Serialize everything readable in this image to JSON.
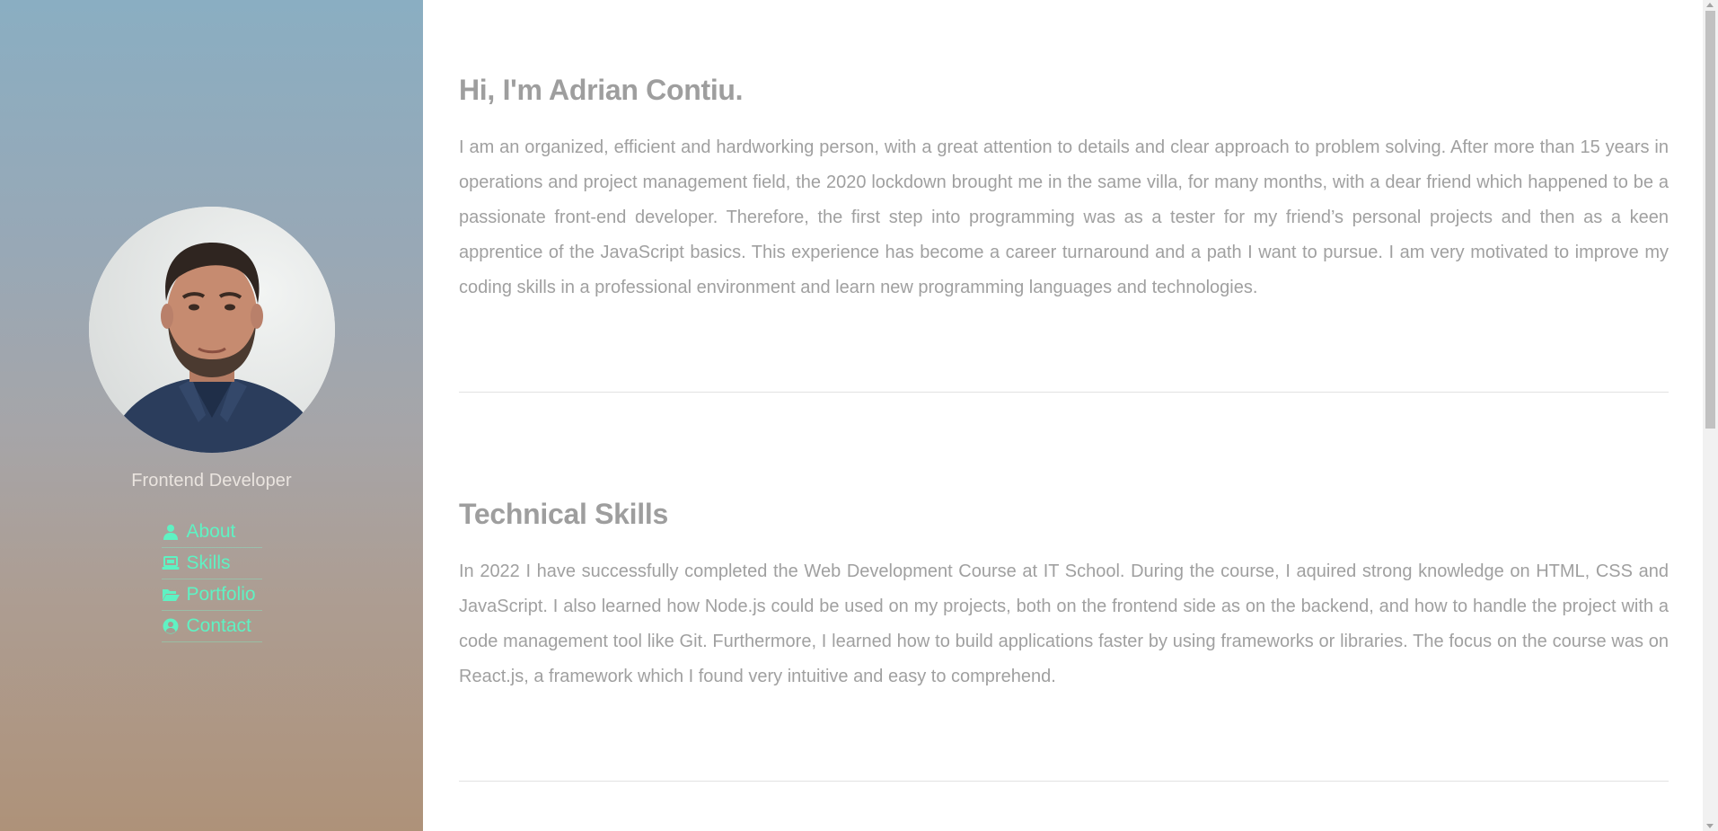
{
  "sidebar": {
    "role": "Frontend Developer",
    "nav": [
      {
        "label": "About",
        "icon": "user-icon"
      },
      {
        "label": "Skills",
        "icon": "laptop-icon"
      },
      {
        "label": "Portfolio",
        "icon": "folder-open-icon"
      },
      {
        "label": "Contact",
        "icon": "user-circle-icon"
      }
    ],
    "accent_color": "#5ff2c3"
  },
  "about": {
    "title": "Hi, I'm Adrian Contiu.",
    "body": "I am an organized, efficient and hardworking person, with a great attention to details and clear approach to problem solving. After more than 15 years in operations and project management field, the 2020 lockdown brought me in the same villa, for many months, with a dear friend which happened to be a passionate front-end developer. Therefore, the first step into programming was as a tester for my friend’s personal projects and then as a keen apprentice of the JavaScript basics. This experience has become a career turnaround and a path I want to pursue. I am very motivated to improve my coding skills in a professional environment and learn new programming languages and technologies."
  },
  "skills": {
    "title": "Technical Skills",
    "body": "In 2022 I have successfully completed the Web Development Course at IT School. During the course, I aquired strong knowledge on HTML, CSS and JavaScript. I also learned how Node.js could be used on my projects, both on the frontend side as on the backend, and how to handle the project with a code management tool like Git. Furthermore, I learned how to build applications faster by using frameworks or libraries. The focus on the course was on React.js, a framework which I found very intuitive and easy to comprehend."
  }
}
